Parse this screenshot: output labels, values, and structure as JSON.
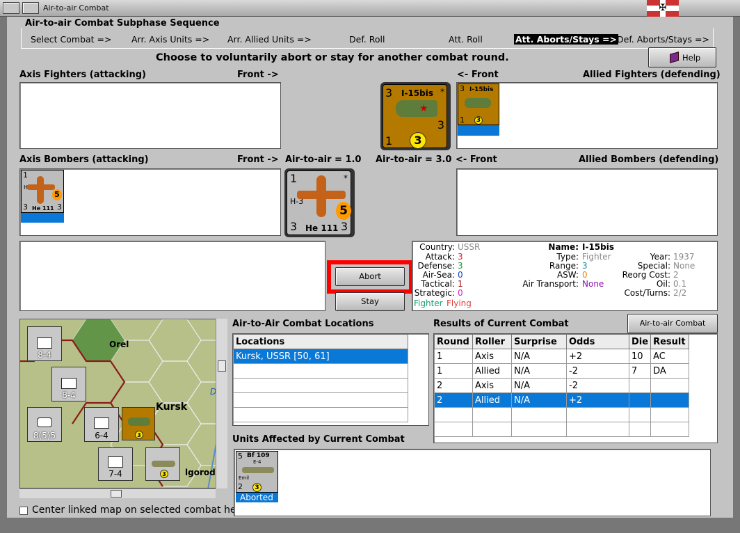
{
  "window": {
    "title": "Air-to-air Combat",
    "flag_symbol": "✠"
  },
  "phase": {
    "heading": "Air-to-air Combat Subphase Sequence",
    "steps": [
      "Select Combat =>",
      "Arr. Axis Units =>",
      "Arr. Allied Units =>",
      "Def. Roll",
      "Att. Roll",
      "Att. Aborts/Stays =>",
      "Def. Aborts/Stays =>"
    ],
    "active_step": 5
  },
  "instruction": "Choose to voluntarily abort or stay for another combat round.",
  "help_label": "Help",
  "sections": {
    "axis_fighters": "Axis Fighters (attacking)",
    "front_right_1": "Front ->",
    "front_left_1": "<- Front",
    "allied_fighters": "Allied Fighters (defending)",
    "axis_bombers": "Axis Bombers (attacking)",
    "front_right_2": "Front ->",
    "air_left": "Air-to-air = 1.0",
    "air_right": "Air-to-air = 3.0",
    "front_left_2": "<- Front",
    "allied_bombers": "Allied Bombers (defending)"
  },
  "units": {
    "i15": {
      "name": "I-15bis",
      "attack": "3",
      "range": "3",
      "defense": "1",
      "air": "3",
      "star": "*"
    },
    "he111": {
      "name": "He 111",
      "model": "H-3",
      "top": "1",
      "air": "5",
      "left": "3",
      "right": "3",
      "star": "*"
    },
    "bf109": {
      "name": "Bf 109",
      "model": "E-4",
      "sub": "Emil",
      "top": "5",
      "left": "2",
      "air": "3",
      "status": "Aborted"
    }
  },
  "buttons": {
    "abort": "Abort",
    "stay": "Stay",
    "chart": "Air-to-air Combat Chart"
  },
  "info": {
    "country_label": "Country:",
    "country": "USSR",
    "attack_label": "Attack:",
    "attack": "3",
    "defense_label": "Defense:",
    "defense": "3",
    "airsea_label": "Air-Sea:",
    "airsea": "0",
    "tactical_label": "Tactical:",
    "tactical": "1",
    "strategic_label": "Strategic:",
    "strategic": "0",
    "fighter_tag": "Fighter",
    "flying_tag": "Flying",
    "name_label": "Name:",
    "name": "I-15bis",
    "type_label": "Type:",
    "type": "Fighter",
    "range_label": "Range:",
    "range": "3",
    "asw_label": "ASW:",
    "asw": "0",
    "transport_label": "Air Transport:",
    "transport": "None",
    "year_label": "Year:",
    "year": "1937",
    "special_label": "Special:",
    "special": "None",
    "reorg_label": "Reorg Cost:",
    "reorg": "2",
    "oil_label": "Oil:",
    "oil": "0.1",
    "cost_label": "Cost/Turns:",
    "cost": "2/2",
    "colors": {
      "country": "#888888",
      "attack": "#e02020",
      "defense": "#1a9a2a",
      "airsea": "#1a3ad8",
      "tactical": "#a01010",
      "strategic": "#d020d0",
      "fighter": "#10a070",
      "flying": "#e04040",
      "range": "#1a8aa8",
      "asw": "#f08000",
      "transport": "#8a10b0",
      "muted": "#888888"
    }
  },
  "locations": {
    "title": "Air-to-Air Combat Locations",
    "header": "Locations",
    "rows": [
      "Kursk, USSR [50, 61]"
    ]
  },
  "results": {
    "title": "Results of Current Combat",
    "headers": [
      "Round",
      "Roller",
      "Surprise",
      "Odds",
      "Die",
      "Result"
    ],
    "rows": [
      [
        "1",
        "Axis",
        "N/A",
        "+2",
        "10",
        "AC"
      ],
      [
        "1",
        "Allied",
        "N/A",
        "-2",
        "7",
        "DA"
      ],
      [
        "2",
        "Axis",
        "N/A",
        "-2",
        "",
        ""
      ],
      [
        "2",
        "Allied",
        "N/A",
        "+2",
        "",
        ""
      ]
    ],
    "selected_row": 3
  },
  "affected": {
    "title": "Units Affected by Current Combat"
  },
  "map": {
    "labels": {
      "orel": "Orel",
      "kursk": "Kursk",
      "belgorod": "lgorod",
      "d": "D"
    },
    "units": [
      {
        "top": "3",
        "value": "8-4",
        "corner": "2"
      },
      {
        "top": "",
        "value": "8-4",
        "corner": "XXX",
        "side": "3"
      },
      {
        "top": "2",
        "value": "8(5)5",
        "corner": "XXXXX",
        "side": "3"
      },
      {
        "top": "",
        "value": "6-4",
        "corner": "XII",
        "side": "3"
      },
      {
        "top": "4",
        "value": "",
        "corner": "I-15bis"
      },
      {
        "top": "2",
        "value": "7-4",
        "corner": "XXX"
      },
      {
        "top": "",
        "value": "",
        "corner": "Bf 109"
      }
    ]
  },
  "center_checkbox": "Center linked map on selected combat hex"
}
